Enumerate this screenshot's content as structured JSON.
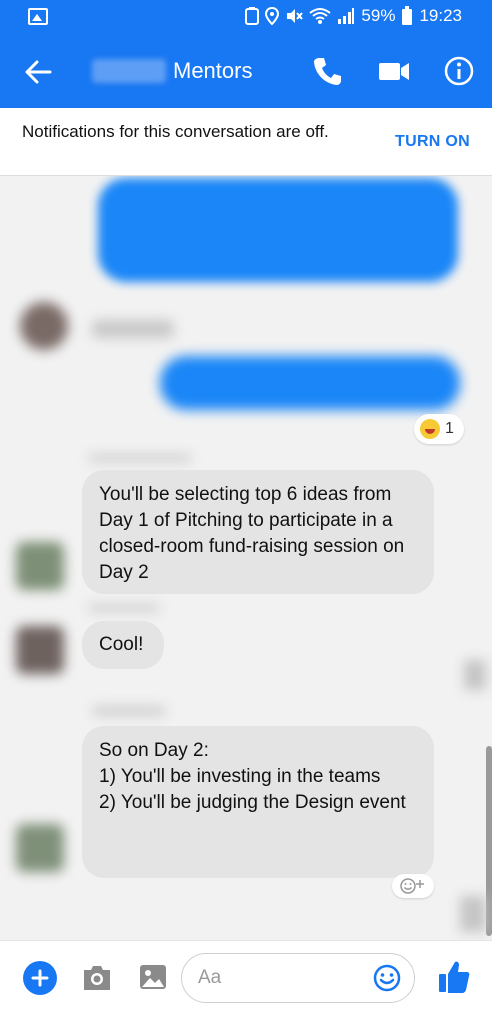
{
  "status": {
    "battery": "59%",
    "time": "19:23"
  },
  "header": {
    "title": "Mentors"
  },
  "notification": {
    "text": "Notifications for this conversation are off.",
    "action": "TURN ON"
  },
  "messages": {
    "reaction_count": "1",
    "m1": "You'll be selecting top 6 ideas from Day 1 of Pitching to participate in a closed-room fund-raising session on Day 2",
    "m2": "Cool!",
    "m3_lines": [
      "So on Day 2:",
      "1) You'll be investing in the teams",
      "2) You'll be judging the Design event"
    ]
  },
  "composer": {
    "placeholder": "Aa"
  },
  "colors": {
    "brand": "#1877f2",
    "bubble_blue": "#1a86f7",
    "bubble_gray": "#e4e4e4"
  },
  "icons": [
    "gallery-icon",
    "back-arrow-icon",
    "phone-icon",
    "video-icon",
    "info-icon",
    "plus-icon",
    "camera-icon",
    "image-icon",
    "emoji-icon",
    "thumbs-up-icon",
    "add-reaction-icon"
  ]
}
